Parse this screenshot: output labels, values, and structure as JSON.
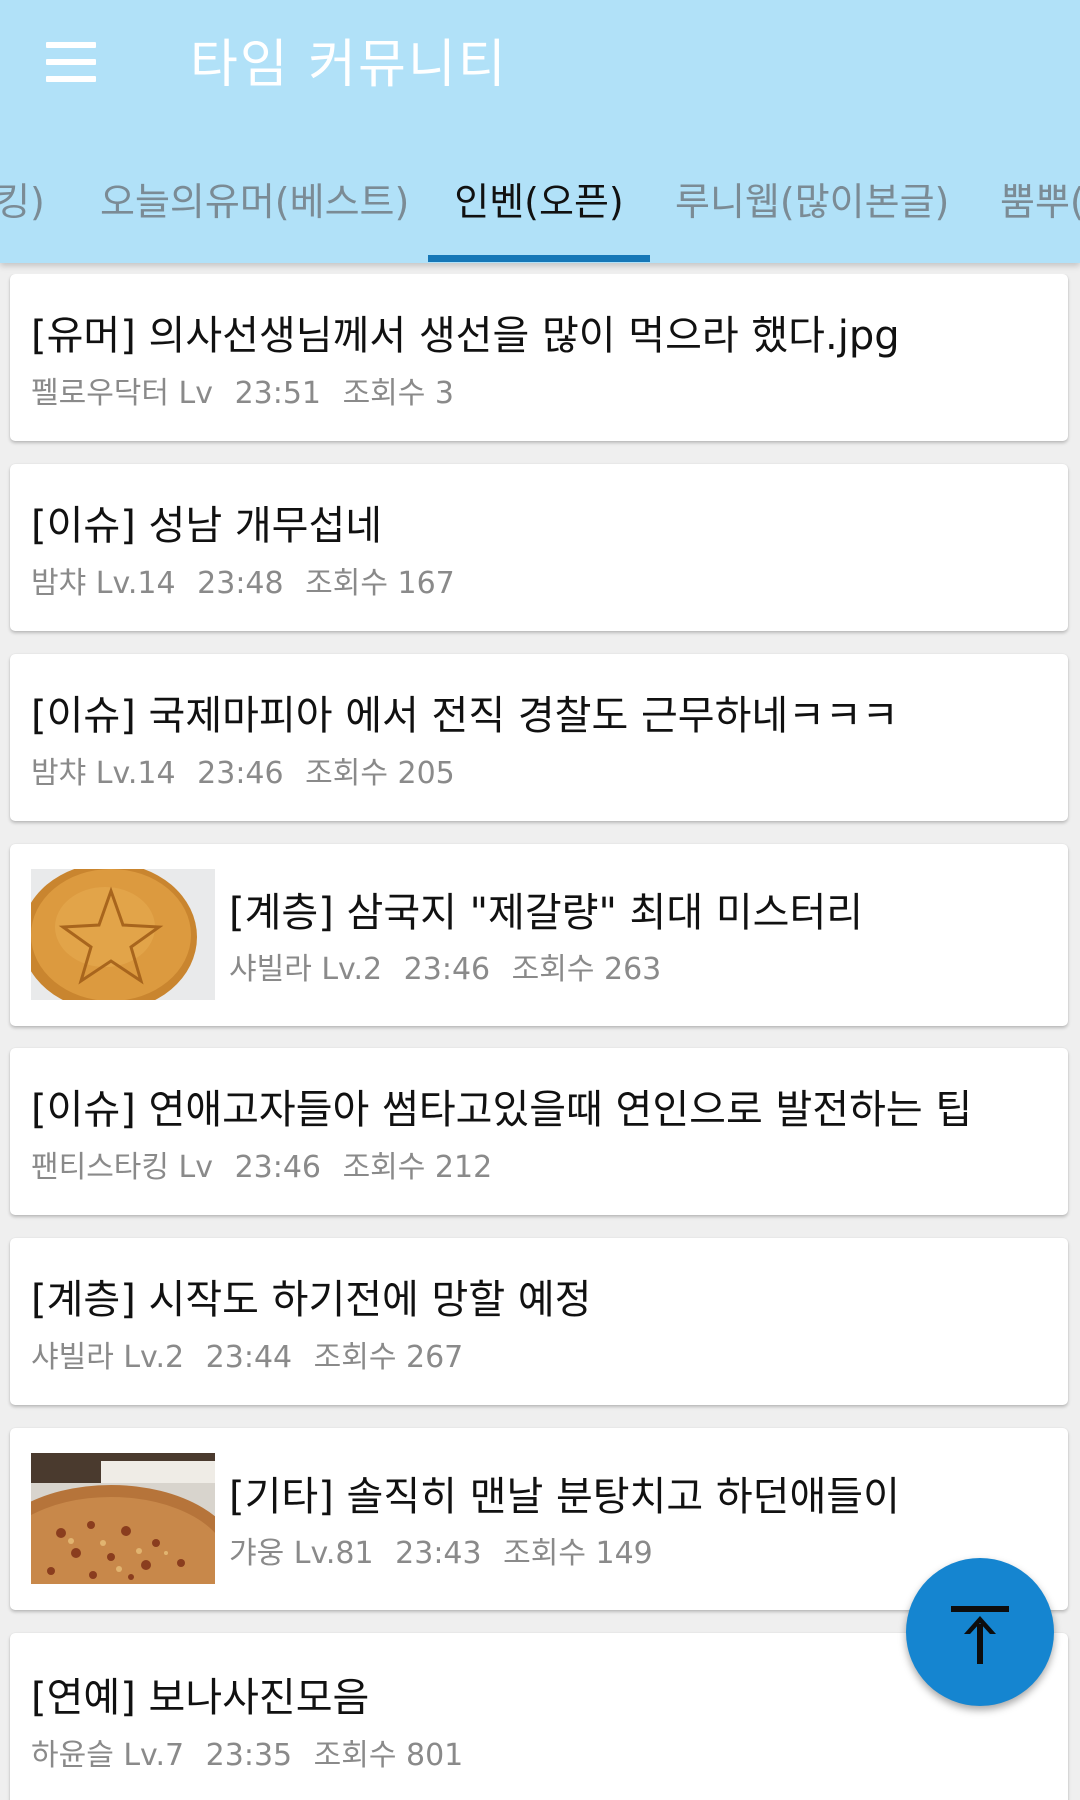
{
  "app": {
    "title": "타임 커뮤니티"
  },
  "tabs": [
    {
      "label": "킹)"
    },
    {
      "label": "오늘의유머(베스트)"
    },
    {
      "label": "인벤(오픈)",
      "active": true
    },
    {
      "label": "루니웹(많이본글)"
    },
    {
      "label": "뿜뿌("
    }
  ],
  "posts": [
    {
      "title": "[유머] 의사선생님께서 생선을 많이 먹으라 했다.jpg",
      "author": "펠로우닥터 Lv",
      "time": "23:51",
      "views": "조회수 3"
    },
    {
      "title": "[이슈] 성남 개무섭네",
      "author": "밤챠 Lv.14",
      "time": "23:48",
      "views": "조회수 167"
    },
    {
      "title": "[이슈] 국제마피아 에서 전직 경찰도 근무하네ㅋㅋㅋ",
      "author": "밤챠 Lv.14",
      "time": "23:46",
      "views": "조회수 205"
    },
    {
      "title": "[계층] 삼국지 \"제갈량\" 최대 미스터리",
      "author": "샤빌라 Lv.2",
      "time": "23:46",
      "views": "조회수 263"
    },
    {
      "title": "[이슈] 연애고자들아 썸타고있을때 연인으로 발전하는 팁",
      "author": "팬티스타킹 Lv",
      "time": "23:46",
      "views": "조회수 212"
    },
    {
      "title": "[계층] 시작도 하기전에 망할 예정",
      "author": "샤빌라 Lv.2",
      "time": "23:44",
      "views": "조회수 267"
    },
    {
      "title": "[기타] 솔직히 맨날 분탕치고 하던애들이",
      "author": "갸웅 Lv.81",
      "time": "23:43",
      "views": "조회수 149"
    },
    {
      "title": "[연예] 보나사진모음",
      "author": "하윤슬 Lv.7",
      "time": "23:35",
      "views": "조회수 801"
    }
  ],
  "colors": {
    "appbar": "#b1e1f8",
    "tab_indicator": "#1677b7",
    "fab": "#1585d0"
  },
  "fab_icon": "arrow-up-to-top-icon"
}
